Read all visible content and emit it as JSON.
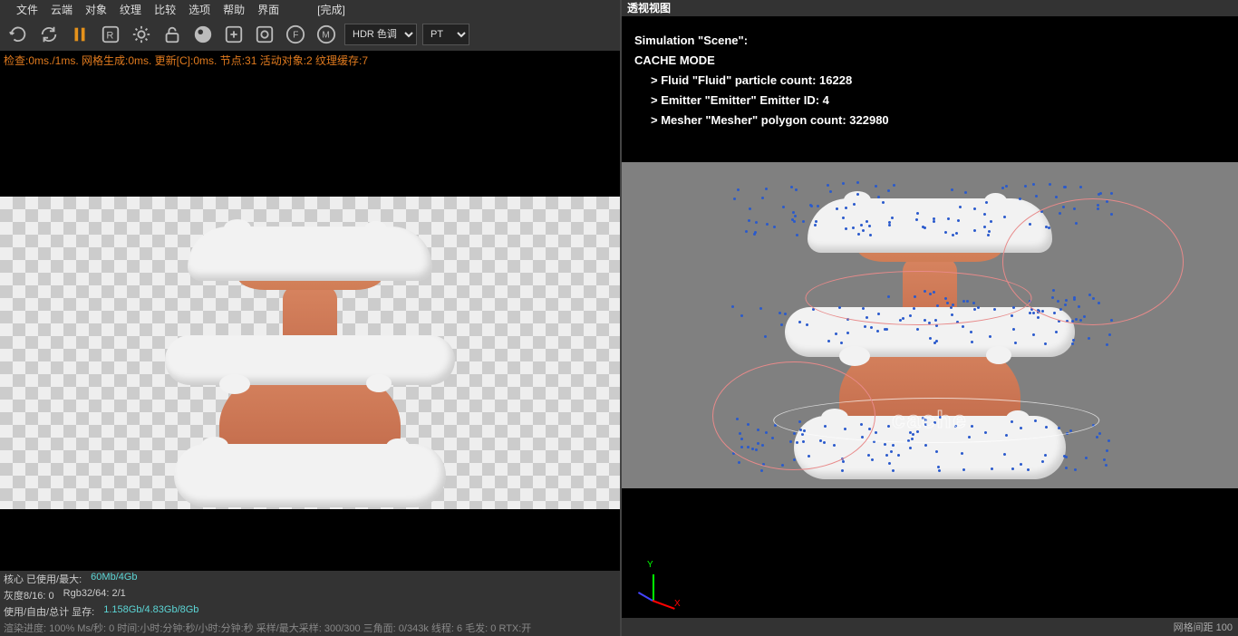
{
  "menu": {
    "items": [
      "文件",
      "云端",
      "对象",
      "纹理",
      "比较",
      "选项",
      "帮助",
      "界面"
    ],
    "done": "[完成]"
  },
  "toolbar": {
    "iconNames": [
      "refresh",
      "cycle",
      "pause",
      "r-box",
      "gear",
      "lock",
      "sphere",
      "add-box",
      "o-box",
      "f-circle",
      "m-circle"
    ],
    "selectHDR": "HDR 色调",
    "selectPT": "PT"
  },
  "status": "检查:0ms./1ms. 网格生成:0ms. 更新[C]:0ms. 节点:31 活动对象:2 纹理缓存:7",
  "stats": {
    "line1_prefix": "核心 已使用/最大:",
    "line1_val": "60Mb/4Gb",
    "line2_a": "灰度8/16: 0",
    "line2_b": "Rgb32/64: 2/1",
    "line3_prefix": "使用/自由/总计 显存:",
    "line3_val": "1.158Gb/4.83Gb/8Gb",
    "line4": "渲染进度: 100%  Ms/秒: 0 时间:小时:分钟:秒/小时:分钟:秒  采样/最大采样: 300/300  三角面: 0/343k  线程: 6  毛发: 0  RTX:开"
  },
  "right": {
    "title": "透视视图",
    "sim_header": "Simulation \"Scene\":",
    "cache_mode": "CACHE MODE",
    "fluid": "> Fluid \"Fluid\" particle count: 16228",
    "emitter": "> Emitter \"Emitter\" Emitter ID: 4",
    "mesher": "> Mesher \"Mesher\" polygon count: 322980",
    "cache_label": "cache",
    "axis_x": "X",
    "axis_y": "Y",
    "bottom": "网格间距  100"
  }
}
